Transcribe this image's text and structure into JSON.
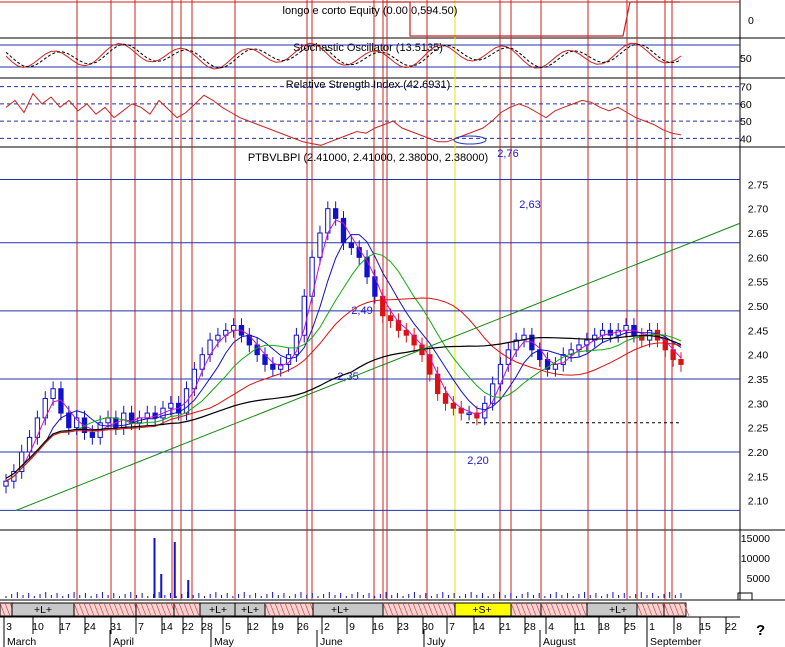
{
  "chart_data": [
    {
      "type": "line",
      "panel": "equity",
      "title": "longo e corto Equity (0.00 0,594.50)",
      "yticks": [
        0
      ]
    },
    {
      "type": "line",
      "panel": "stochastic",
      "title": "Stochastic Oscillator (13.5135)",
      "yticks": [
        50
      ]
    },
    {
      "type": "line",
      "panel": "rsi",
      "title": "Relative Strength Index (42.6931)",
      "yticks": [
        70,
        60,
        50,
        40
      ],
      "ylim": [
        35,
        75
      ],
      "series_rsi": [
        58,
        62,
        55,
        66,
        60,
        64,
        58,
        62,
        56,
        60,
        54,
        58,
        52,
        56,
        60,
        58,
        54,
        62,
        57,
        52,
        55,
        60,
        65,
        62,
        58,
        55,
        52,
        50,
        48,
        46,
        44,
        42,
        40,
        38,
        37,
        36,
        38,
        40,
        42,
        44,
        43,
        46,
        48,
        50,
        46,
        44,
        42,
        40,
        38,
        38,
        40,
        42,
        44,
        46,
        50,
        55,
        58,
        60,
        58,
        55,
        52,
        56,
        58,
        60,
        62,
        61,
        58,
        56,
        58,
        55,
        52,
        50,
        48,
        45,
        43,
        42
      ]
    },
    {
      "type": "candlestick",
      "panel": "price",
      "title": "PTBVLBPI (2.41000, 2.41000, 2.38000, 2.38000)",
      "ylim": [
        2.05,
        2.8
      ],
      "yticks": [
        2.75,
        2.7,
        2.65,
        2.6,
        2.55,
        2.5,
        2.45,
        2.4,
        2.35,
        2.3,
        2.25,
        2.2,
        2.15,
        2.1
      ],
      "close": [
        2.14,
        2.16,
        2.2,
        2.23,
        2.27,
        2.31,
        2.33,
        2.28,
        2.25,
        2.27,
        2.24,
        2.23,
        2.26,
        2.27,
        2.25,
        2.28,
        2.26,
        2.27,
        2.28,
        2.27,
        2.29,
        2.3,
        2.28,
        2.33,
        2.37,
        2.4,
        2.43,
        2.44,
        2.45,
        2.46,
        2.44,
        2.42,
        2.4,
        2.38,
        2.37,
        2.38,
        2.4,
        2.44,
        2.52,
        2.6,
        2.65,
        2.7,
        2.68,
        2.63,
        2.62,
        2.6,
        2.56,
        2.52,
        2.48,
        2.47,
        2.45,
        2.44,
        2.42,
        2.4,
        2.36,
        2.32,
        2.3,
        2.29,
        2.28,
        2.28,
        2.27,
        2.3,
        2.34,
        2.38,
        2.41,
        2.43,
        2.44,
        2.41,
        2.39,
        2.37,
        2.38,
        2.4,
        2.41,
        2.42,
        2.43,
        2.44,
        2.45,
        2.44,
        2.45,
        2.46,
        2.44,
        2.43,
        2.45,
        2.43,
        2.41,
        2.39,
        2.38
      ],
      "horizontal_levels": [
        2.76,
        2.63,
        2.49,
        2.35,
        2.2
      ],
      "level_labels": [
        "2,76",
        "2,63",
        "2,49",
        "2,35",
        "2,20"
      ],
      "trendline": [
        [
          0.1,
          2.08
        ],
        [
          1.0,
          2.67
        ]
      ]
    },
    {
      "type": "bar",
      "panel": "volume",
      "yticks": [
        15000,
        10000,
        5000
      ],
      "spikes": [
        [
          0.22,
          15000
        ],
        [
          0.25,
          14000
        ],
        [
          0.23,
          6000
        ],
        [
          0.27,
          4500
        ]
      ]
    }
  ],
  "signal_strip": {
    "labels": [
      "+L+",
      "+L+",
      "+L+",
      "+L+",
      "+S+",
      "+L+"
    ]
  },
  "time_axis": {
    "days": [
      "3",
      "10",
      "17",
      "24",
      "31",
      "7",
      "14",
      "22",
      "28",
      "5",
      "12",
      "19",
      "26",
      "2",
      "9",
      "16",
      "23",
      "30",
      "7",
      "14",
      "21",
      "28",
      "4",
      "11",
      "18",
      "25",
      "1",
      "8",
      "15",
      "22"
    ],
    "months": [
      "March",
      "April",
      "May",
      "June",
      "July",
      "August",
      "September"
    ]
  },
  "question_mark": "?"
}
